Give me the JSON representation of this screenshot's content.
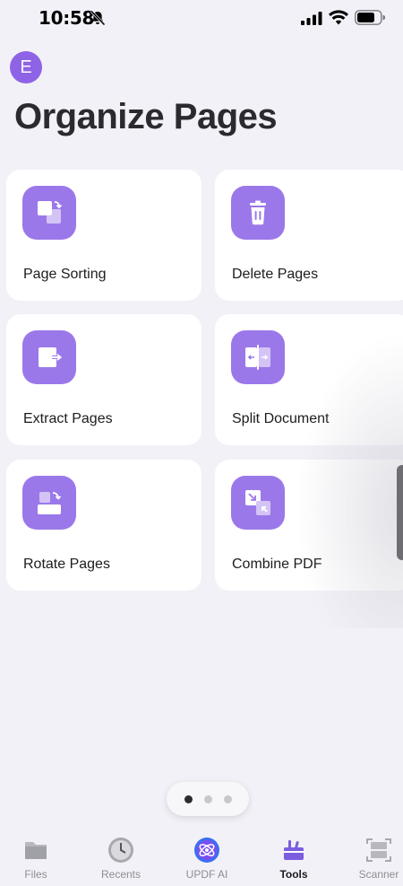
{
  "status": {
    "time": "10:58",
    "icons": [
      "bell-slash-icon",
      "cellular-signal-icon",
      "wifi-icon",
      "battery-icon"
    ]
  },
  "avatar": {
    "initial": "E",
    "color": "#8e63e6"
  },
  "page_title": "Organize Pages",
  "accent_color": "#9b78ea",
  "tools": [
    {
      "label": "Page Sorting",
      "icon": "page-sorting-icon"
    },
    {
      "label": "Delete Pages",
      "icon": "trash-icon"
    },
    {
      "label": "Extract Pages",
      "icon": "extract-pages-icon"
    },
    {
      "label": "Split Document",
      "icon": "split-document-icon"
    },
    {
      "label": "Rotate Pages",
      "icon": "rotate-pages-icon"
    },
    {
      "label": "Combine PDF",
      "icon": "combine-pdf-icon"
    }
  ],
  "pager": {
    "pages": 3,
    "current": 1
  },
  "tab_bar": {
    "items": [
      {
        "label": "Files",
        "icon": "folder-icon",
        "active": false
      },
      {
        "label": "Recents",
        "icon": "clock-icon",
        "active": false
      },
      {
        "label": "UPDF AI",
        "icon": "updf-ai-icon",
        "active": false
      },
      {
        "label": "Tools",
        "icon": "toolbox-icon",
        "active": true
      },
      {
        "label": "Scanner",
        "icon": "scanner-icon",
        "active": false
      }
    ]
  }
}
